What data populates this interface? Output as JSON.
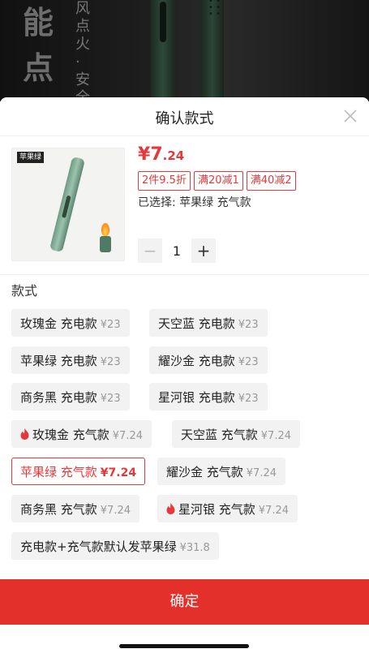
{
  "banner": {
    "chars": "能点火",
    "vertical_text": "风点火·安全稳"
  },
  "sheet": {
    "title": "确认款式",
    "close_icon": "close-icon"
  },
  "product": {
    "thumb_label": "苹果绿",
    "thumb_sub_label": "",
    "price_symbol": "¥",
    "price_int": "7",
    "price_dec": ".24",
    "promos": [
      "2件9.5折",
      "满20减1",
      "满40减2"
    ],
    "selected": "已选择: 苹果绿 充气款"
  },
  "stepper": {
    "minus": "−",
    "value": "1",
    "plus": "+"
  },
  "section": {
    "label": "款式"
  },
  "options": [
    {
      "name": "玫瑰金 充电款",
      "price": "¥23",
      "hot": false,
      "selected": false
    },
    {
      "name": "天空蓝 充电款",
      "price": "¥23",
      "hot": false,
      "selected": false
    },
    {
      "name": "苹果绿 充电款",
      "price": "¥23",
      "hot": false,
      "selected": false
    },
    {
      "name": "耀沙金 充电款",
      "price": "¥23",
      "hot": false,
      "selected": false
    },
    {
      "name": "商务黑 充电款",
      "price": "¥23",
      "hot": false,
      "selected": false
    },
    {
      "name": "星河银 充电款",
      "price": "¥23",
      "hot": false,
      "selected": false
    },
    {
      "name": "玫瑰金 充气款",
      "price": "¥7.24",
      "hot": true,
      "selected": false
    },
    {
      "name": "天空蓝 充气款",
      "price": "¥7.24",
      "hot": false,
      "selected": false
    },
    {
      "name": "苹果绿 充气款",
      "price": "¥7.24",
      "hot": false,
      "selected": true
    },
    {
      "name": "耀沙金 充气款",
      "price": "¥7.24",
      "hot": false,
      "selected": false
    },
    {
      "name": "商务黑 充气款",
      "price": "¥7.24",
      "hot": false,
      "selected": false
    },
    {
      "name": "星河银 充气款",
      "price": "¥7.24",
      "hot": true,
      "selected": false
    },
    {
      "name": "充电款+充气款默认发苹果绿",
      "price": "¥31.8",
      "hot": false,
      "selected": false
    }
  ],
  "confirm_label": "确定",
  "colors": {
    "accent": "#e4393c",
    "confirm_bg": "#e4302b"
  }
}
